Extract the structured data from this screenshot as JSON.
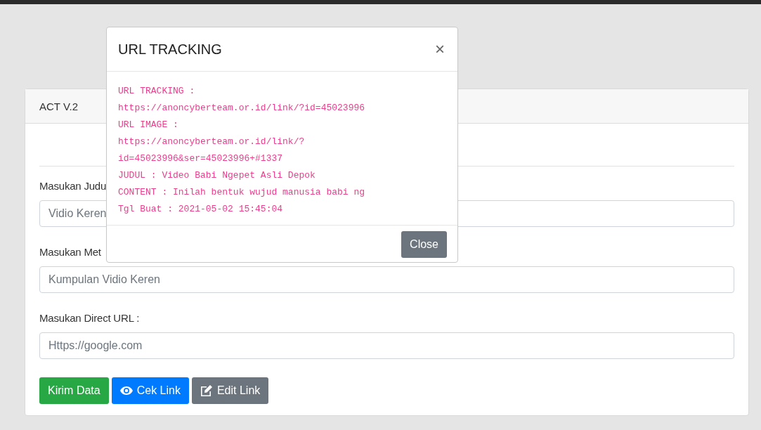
{
  "card": {
    "title": "ACT V.2",
    "fields": [
      {
        "label": "Masukan Judu",
        "placeholder": "Vidio Keren"
      },
      {
        "label": "Masukan Met",
        "placeholder": "Kumpulan Vidio Keren"
      },
      {
        "label": "Masukan Direct URL :",
        "placeholder": "Https://google.com"
      }
    ],
    "buttons": [
      {
        "kind": "submit",
        "label": "Kirim Data"
      },
      {
        "kind": "view",
        "label": "Cek Link"
      },
      {
        "kind": "edit",
        "label": "Edit Link"
      }
    ]
  },
  "modal": {
    "title": "URL TRACKING",
    "close": "×",
    "lines": [
      "URL TRACKING :",
      "https://anoncyberteam.or.id/link/?id=45023996",
      "URL IMAGE :",
      "https://anoncyberteam.or.id/link/?",
      "id=45023996&ser=45023996+#1337",
      "JUDUL : Video Babi Ngepet Asli Depok",
      "CONTENT : Inilah bentuk wujud manusia babi ng",
      "Tgl Buat : 2021-05-02 15:45:04"
    ],
    "button": "Close"
  }
}
